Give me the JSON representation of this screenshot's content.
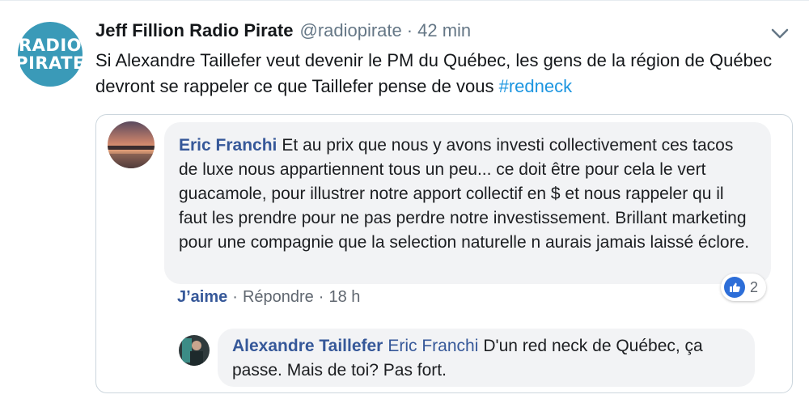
{
  "tweet": {
    "avatar_lines": [
      "RADIO",
      "PIRATE"
    ],
    "display_name": "Jeff Fillion Radio Pirate",
    "handle": "@radiopirate",
    "separator": "·",
    "time": "42 min",
    "text": "Si Alexandre Taillefer veut devenir le PM du Québec, les gens de la région de Québec devront se rappeler ce que Taillefer pense de vous ",
    "hashtag": "#redneck",
    "menu_icon": "chevron-down-icon"
  },
  "embedded": {
    "comment": {
      "author": "Eric Franchi",
      "text": "Et au prix que nous y avons investi collectivement ces tacos de luxe nous appartiennent tous un peu... ce doit être pour cela le vert guacamole, pour illustrer notre apport collectif en $ et nous rappeler qu il faut les prendre pour ne pas perdre notre investissement. Brillant marketing pour une compagnie que la selection naturelle n aurais jamais laissé éclore.",
      "like_label": "J’aime",
      "sep": "·",
      "reply_label": "Répondre",
      "time": "18 h",
      "reaction_count": "2",
      "reaction_icon": "like-thumb-icon"
    },
    "reply": {
      "author": "Alexandre Taillefer",
      "mention": "Eric Franchi",
      "text": "D'un red neck de Québec, ça passe. Mais de toi? Pas fort."
    }
  },
  "colors": {
    "link_blue": "#1b95e0",
    "fb_blue": "#365899",
    "avatar_teal": "#3a9ab8",
    "bubble_gray": "#f2f3f5"
  }
}
